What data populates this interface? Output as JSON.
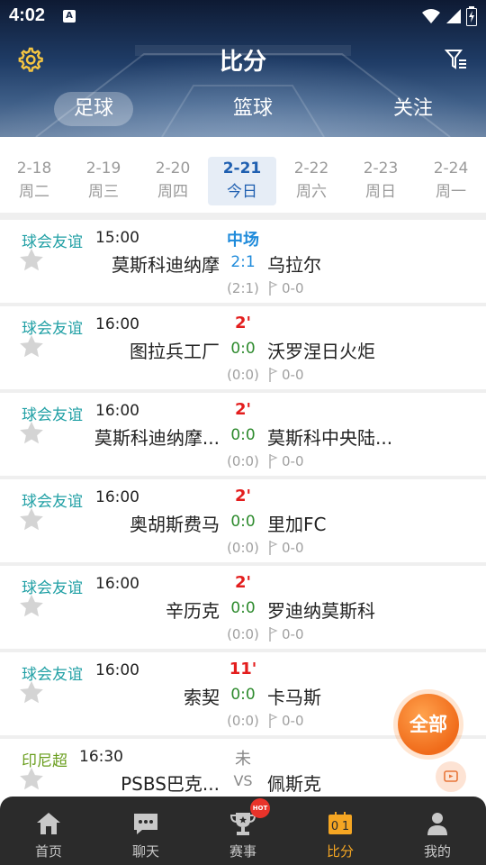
{
  "status_bar": {
    "time": "4:02",
    "a_label": "A"
  },
  "header": {
    "title": "比分"
  },
  "sport_tabs": [
    {
      "label": "足球",
      "active": true
    },
    {
      "label": "篮球",
      "active": false
    },
    {
      "label": "关注",
      "active": false
    }
  ],
  "dates": [
    {
      "date": "2-18",
      "weekday": "周二"
    },
    {
      "date": "2-19",
      "weekday": "周三"
    },
    {
      "date": "2-20",
      "weekday": "周四"
    },
    {
      "date": "2-21",
      "weekday": "今日",
      "active": true
    },
    {
      "date": "2-22",
      "weekday": "周六"
    },
    {
      "date": "2-23",
      "weekday": "周日"
    },
    {
      "date": "2-24",
      "weekday": "周一"
    }
  ],
  "matches": [
    {
      "league": "球会友谊",
      "time": "15:00",
      "status": "中场",
      "home": "莫斯科迪纳摩",
      "score": "2:1",
      "away": "乌拉尔",
      "half": "(2:1)",
      "corner": "0-0"
    },
    {
      "league": "球会友谊",
      "time": "16:00",
      "status": "2'",
      "home": "图拉兵工厂",
      "score": "0:0",
      "away": "沃罗涅日火炬",
      "half": "(0:0)",
      "corner": "0-0"
    },
    {
      "league": "球会友谊",
      "time": "16:00",
      "status": "2'",
      "home": "莫斯科迪纳摩...",
      "score": "0:0",
      "away": "莫斯科中央陆...",
      "half": "(0:0)",
      "corner": "0-0"
    },
    {
      "league": "球会友谊",
      "time": "16:00",
      "status": "2'",
      "home": "奥胡斯费马",
      "score": "0:0",
      "away": "里加FC",
      "half": "(0:0)",
      "corner": "0-0"
    },
    {
      "league": "球会友谊",
      "time": "16:00",
      "status": "2'",
      "home": "辛历克",
      "score": "0:0",
      "away": "罗迪纳莫斯科",
      "half": "(0:0)",
      "corner": "0-0"
    },
    {
      "league": "球会友谊",
      "time": "16:00",
      "status": "11'",
      "home": "索契",
      "score": "0:0",
      "away": "卡马斯",
      "half": "(0:0)",
      "corner": "0-0"
    },
    {
      "league": "印尼超",
      "time": "16:30",
      "status": "未",
      "home": "PSBS巴克...",
      "score": "VS",
      "away": "佩斯克"
    }
  ],
  "fab": {
    "label": "全部"
  },
  "bottom_nav": [
    {
      "label": "首页",
      "icon": "home-icon"
    },
    {
      "label": "聊天",
      "icon": "chat-icon"
    },
    {
      "label": "赛事",
      "icon": "trophy-icon",
      "badge": "HOT"
    },
    {
      "label": "比分",
      "icon": "scoreboard-icon",
      "active": true
    },
    {
      "label": "我的",
      "icon": "profile-icon"
    }
  ],
  "colors": {
    "accent": "#1f5fb0",
    "live": "#e31d1d",
    "halftime": "#1f8bdb",
    "league": "#21a0a5",
    "nav_active": "#f5a623",
    "fab": "#f06b1a"
  }
}
